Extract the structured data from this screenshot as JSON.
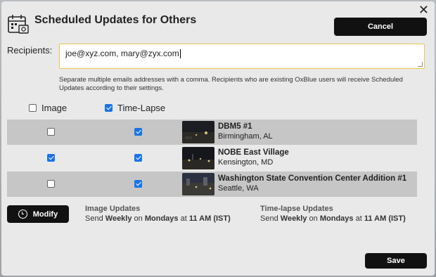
{
  "dialog": {
    "title": "Scheduled Updates for Others",
    "close_glyph": "✕",
    "cancel_label": "Cancel",
    "save_label": "Save",
    "accent_color": "#1a73e8"
  },
  "recipients": {
    "label": "Recipients:",
    "value": "joe@xyz.com, mary@zyx.com",
    "help": "Separate multiple emails addresses with a comma. Recipients who are existing OxBlue users will receive Scheduled Updates according to their settings."
  },
  "columns": {
    "image_label": "Image",
    "image_checked": false,
    "timelapse_label": "Time-Lapse",
    "timelapse_checked": true
  },
  "cameras": [
    {
      "name": "DBM5 #1",
      "location": "Birmingham, AL",
      "image": false,
      "timelapse": true
    },
    {
      "name": "NOBE East Village",
      "location": "Kensington, MD",
      "image": true,
      "timelapse": true
    },
    {
      "name": "Washington State Convention Center Addition #1",
      "location": "Seattle, WA",
      "image": false,
      "timelapse": true
    }
  ],
  "modify": {
    "label": "Modify",
    "icon": "clock-icon"
  },
  "image_updates": {
    "title": "Image Updates",
    "prefix": "Send",
    "frequency": "Weekly",
    "on": "on",
    "day": "Mondays",
    "at": "at",
    "time": "11 AM",
    "tz": "(IST)"
  },
  "timelapse_updates": {
    "title": "Time-lapse Updates",
    "prefix": "Send",
    "frequency": "Weekly",
    "on": "on",
    "day": "Mondays",
    "at": "at",
    "time": "11 AM",
    "tz": "(IST)"
  }
}
